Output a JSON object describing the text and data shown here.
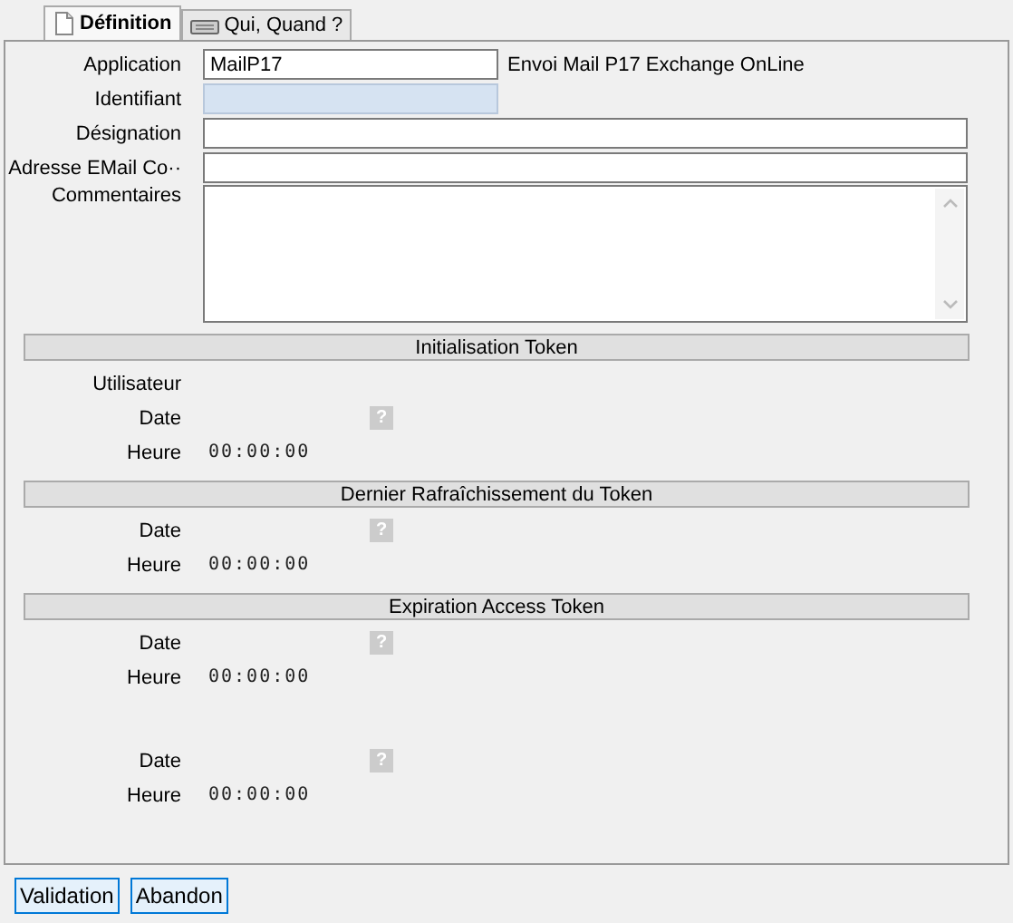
{
  "tabs": [
    {
      "label": "Définition",
      "selected": true
    },
    {
      "label": "Qui, Quand ?",
      "selected": false
    }
  ],
  "fields": [
    {
      "label": "Application",
      "value": "MailP17",
      "note": "Envoi Mail P17 Exchange OnLine",
      "readonly": false
    },
    {
      "label": "Identifiant",
      "readonly": true
    },
    {
      "label": "Désignation",
      "readonly": false
    },
    {
      "label": "Adresse EMail Co··",
      "readonly": false
    }
  ],
  "comments": {
    "label": "Commentaires"
  },
  "sections": [
    {
      "title": "Initialisation Token",
      "rows": [
        {
          "kind": "user",
          "label": "Utilisateur"
        },
        {
          "kind": "date",
          "label": "Date",
          "button": "?"
        },
        {
          "kind": "time",
          "label": "Heure",
          "value": "00:00:00"
        }
      ]
    },
    {
      "title": "Dernier Rafraîchissement du Token",
      "rows": [
        {
          "kind": "date",
          "label": "Date",
          "button": "?"
        },
        {
          "kind": "time",
          "label": "Heure",
          "value": "00:00:00"
        }
      ]
    },
    {
      "title": "Expiration  Access Token",
      "rows": [
        {
          "kind": "date",
          "label": "Date",
          "button": "?"
        },
        {
          "kind": "time",
          "label": "Heure",
          "value": "00:00:00"
        }
      ]
    },
    {
      "rows": [
        {
          "kind": "date",
          "label": "Date",
          "button": "?"
        },
        {
          "kind": "time",
          "label": "Heure",
          "value": "00:00:00"
        }
      ]
    }
  ],
  "buttons": [
    "Validation",
    "Abandon"
  ]
}
